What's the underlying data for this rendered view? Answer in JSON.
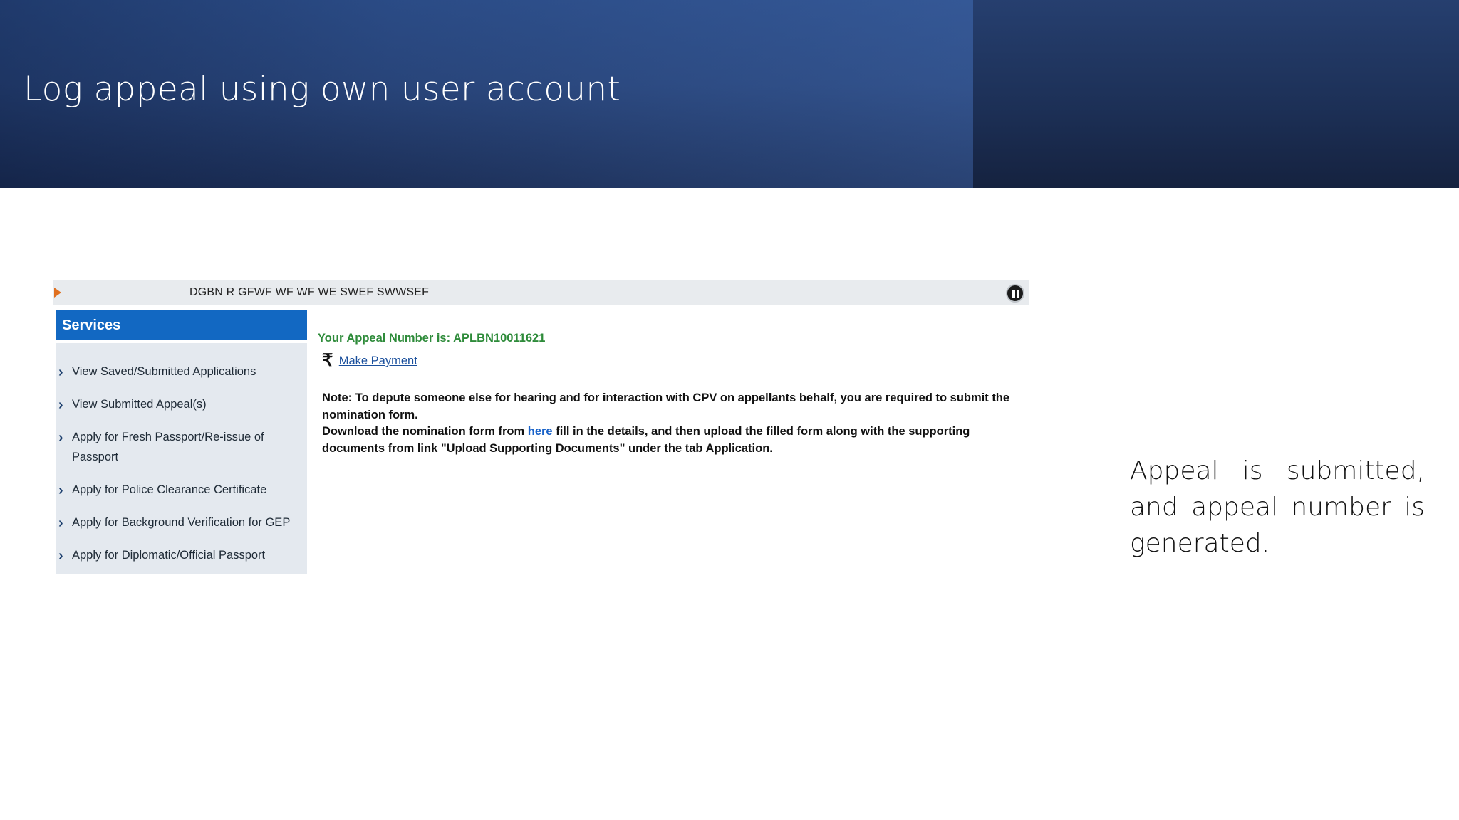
{
  "slide": {
    "title": "Log appeal using own user account",
    "caption": "Appeal is submitted, and appeal number is generated."
  },
  "screenshot": {
    "ticker": {
      "text": "DGBN R GFWF WF WF WE SWEF SWWSEF",
      "pause_icon": "pause-circle-icon"
    },
    "sidebar": {
      "header": "Services",
      "items": [
        {
          "label": "View Saved/Submitted Applications"
        },
        {
          "label": "View Submitted Appeal(s)"
        },
        {
          "label": "Apply for Fresh Passport/Re-issue of Passport"
        },
        {
          "label": "Apply for Police Clearance Certificate"
        },
        {
          "label": "Apply for Background Verification for GEP"
        },
        {
          "label": "Apply for Diplomatic/Official Passport"
        }
      ]
    },
    "content": {
      "appeal_number_text": "Your Appeal Number is: APLBN10011621",
      "payment_icon": "rupee-icon",
      "make_payment_label": "Make Payment",
      "note_line1": "Note: To depute someone else for hearing and for interaction with CPV on appellants behalf, you are required to submit the nomination form.",
      "note_line2_prefix": "Download the nomination form from",
      "note_link": "here",
      "note_line2_suffix": "fill in the details, and then upload the filled form along with the supporting documents from link \"Upload Supporting Documents\" under the tab Application."
    }
  },
  "colors": {
    "title_band": "#284478",
    "sidebar_header": "#1268c2",
    "sidebar_bg": "#e4e9ef",
    "appeal_green": "#2e8b3a",
    "link_blue": "#1a4f9c",
    "ticker_arrow": "#e07020"
  }
}
